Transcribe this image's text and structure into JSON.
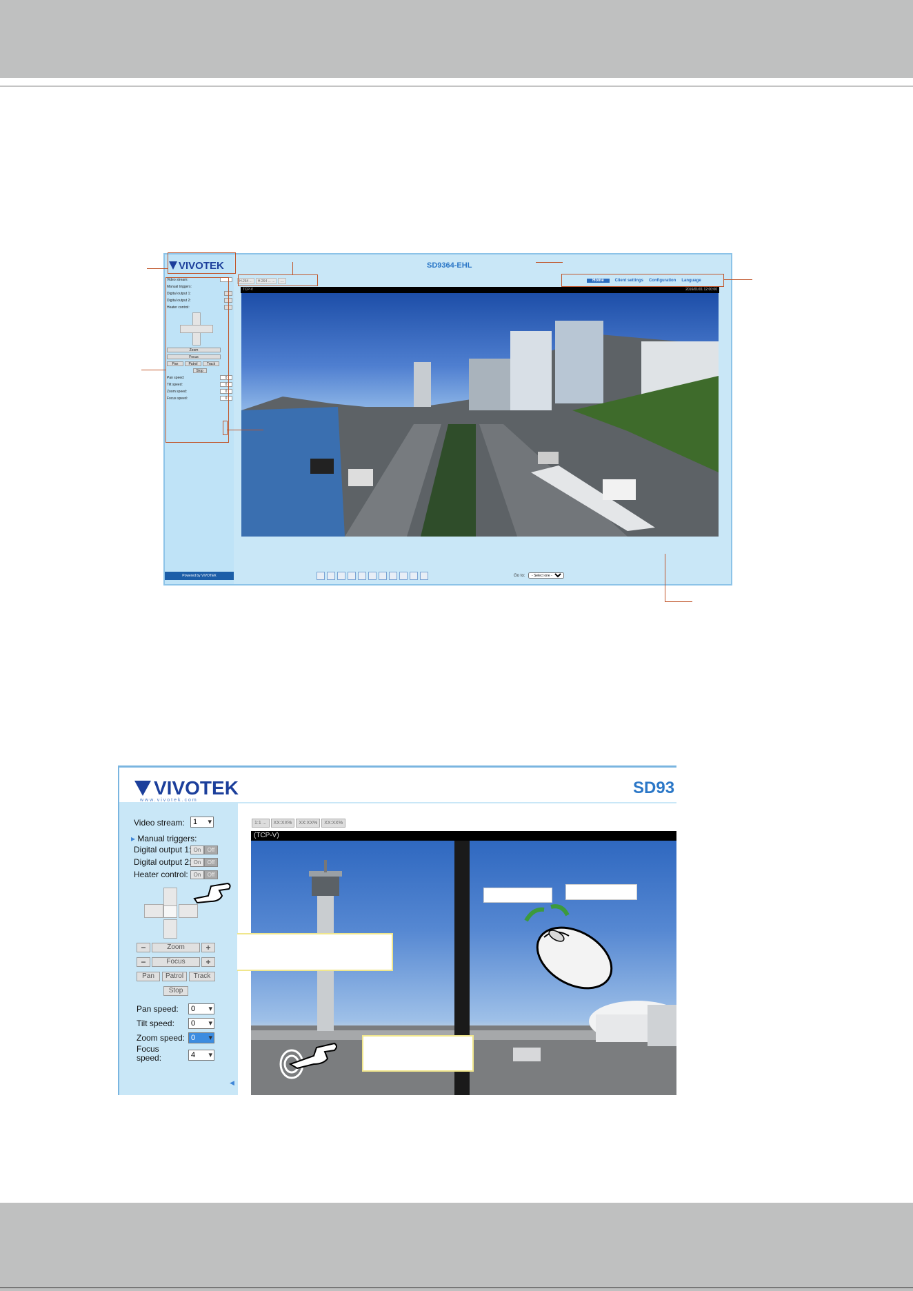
{
  "shot1": {
    "brand": "VIVOTEK",
    "model_title": "SD9364-EHL",
    "tabs": [
      "H.264 ...",
      "H.264 ... ...",
      "...."
    ],
    "nav": {
      "home": "Home",
      "client_settings": "Client settings",
      "configuration": "Configuration",
      "language": "Language"
    },
    "video_status_left": "TCP-V",
    "video_status_right": "2016/01/01 12:00:00",
    "sidebar": {
      "video_stream_label": "Video stream:",
      "video_stream_value": "1",
      "manual_triggers_label": "Manual triggers:",
      "digital_output_1": "Digital output 1:",
      "digital_output_2": "Digital output 2:",
      "heater_control": "Heater control:",
      "zoom_label": "Zoom",
      "focus_label": "Focus",
      "pan_label": "Pan",
      "patrol_label": "Patrol",
      "track_label": "Track",
      "stop_label": "Stop",
      "pan_speed": "Pan speed:",
      "tilt_speed": "Tilt speed:",
      "zoom_speed": "Zoom speed:",
      "focus_speed": "Focus speed:",
      "speed_value": "0"
    },
    "goto_label": "Go to:",
    "goto_value": "- Select one -",
    "powered_by": "Powered by VIVOTEK"
  },
  "shot2": {
    "brand": "VIVOTEK",
    "brand_sub": "www.vivotek.com",
    "model_title": "SD93",
    "tabs": [
      "1:1 ...",
      "XX:XX%",
      "XX:XX%",
      "XX:XX%"
    ],
    "video_status": "(TCP-V)",
    "sidebar": {
      "video_stream_label": "Video stream:",
      "video_stream_value": "1",
      "manual_triggers_label": "Manual triggers:",
      "digital_output_1": "Digital output 1:",
      "digital_output_2": "Digital output 2:",
      "heater_control": "Heater control:",
      "on": "On",
      "off": "Off",
      "zoom_label": "Zoom",
      "focus_label": "Focus",
      "pan_label": "Pan",
      "patrol_label": "Patrol",
      "track_label": "Track",
      "stop_label": "Stop",
      "pan_speed": "Pan speed:",
      "tilt_speed": "Tilt speed:",
      "zoom_speed": "Zoom speed:",
      "focus_speed_line1": "Focus",
      "focus_speed_line2": "speed:",
      "pan_speed_value": "0",
      "tilt_speed_value": "0",
      "zoom_speed_value": "0",
      "focus_speed_value": "4"
    }
  },
  "colors": {
    "band": "#bfc0c0",
    "panel": "#c9e7f7",
    "brand_blue": "#1c3f9b",
    "title_blue": "#2b77c7",
    "annotation": "#c0552a",
    "callout_border": "#f0e68c"
  }
}
